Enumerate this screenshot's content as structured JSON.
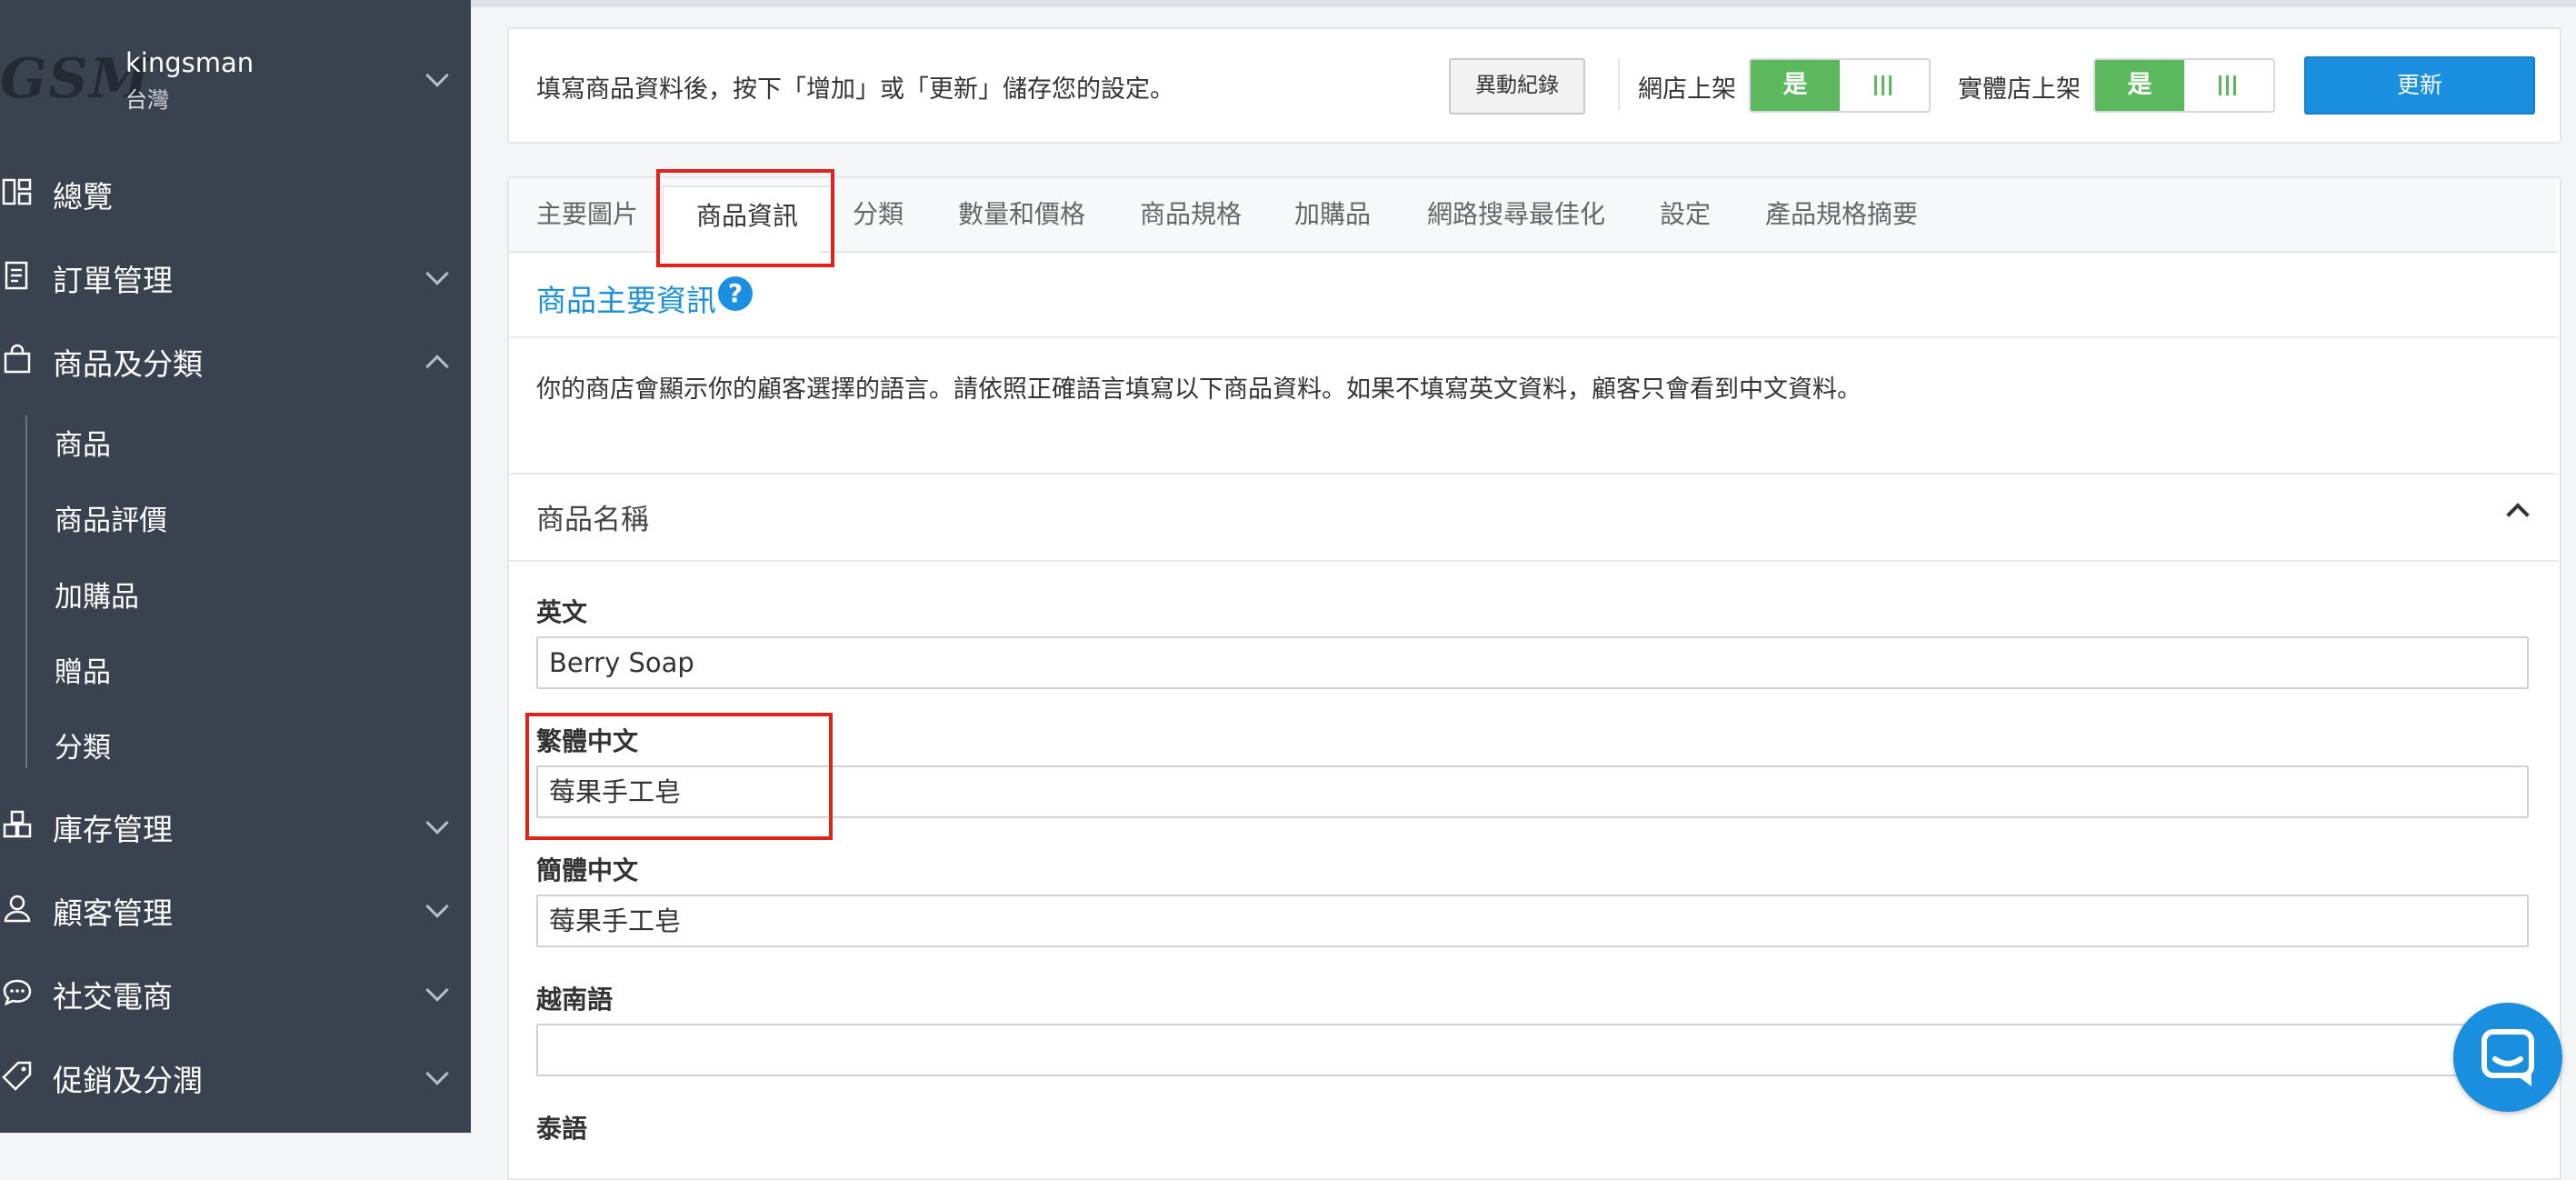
{
  "sidebar": {
    "brand_logo": "GSM",
    "account_name": "kingsman",
    "account_region": "台灣",
    "nav": {
      "overview": "總覽",
      "orders": "訂單管理",
      "products": "商品及分類",
      "inventory": "庫存管理",
      "customers": "顧客管理",
      "social": "社交電商",
      "promotions": "促銷及分潤"
    },
    "sub_items": [
      "商品",
      "商品評價",
      "加購品",
      "贈品",
      "分類"
    ]
  },
  "toolbar": {
    "notice": "填寫商品資料後，按下「增加」或「更新」儲存您的設定。",
    "change_log_label": "異動紀錄",
    "online_store_label": "網店上架",
    "online_store_value": "是",
    "physical_store_label": "實體店上架",
    "physical_store_value": "是",
    "update_label": "更新"
  },
  "tabs": [
    "主要圖片",
    "商品資訊",
    "分類",
    "數量和價格",
    "商品規格",
    "加購品",
    "網路搜尋最佳化",
    "設定",
    "產品規格摘要"
  ],
  "active_tab": "商品資訊",
  "content": {
    "section_title": "商品主要資訊",
    "help_glyph": "?",
    "description": "你的商店會顯示你的顧客選擇的語言。請依照正確語言填寫以下商品資料。如果不填寫英文資料，顧客只會看到中文資料。",
    "subheading": "商品名稱",
    "fields": [
      {
        "label": "英文",
        "value": "Berry Soap"
      },
      {
        "label": "繁體中文",
        "value": "莓果手工皂"
      },
      {
        "label": "簡體中文",
        "value": "莓果手工皂"
      },
      {
        "label": "越南語",
        "value": ""
      },
      {
        "label": "泰語",
        "value": ""
      }
    ]
  },
  "colors": {
    "sidebar_bg": "#3a4250",
    "accent_blue": "#1a8fe0",
    "toggle_green": "#5cb85c",
    "highlight_red": "#e0241b"
  }
}
